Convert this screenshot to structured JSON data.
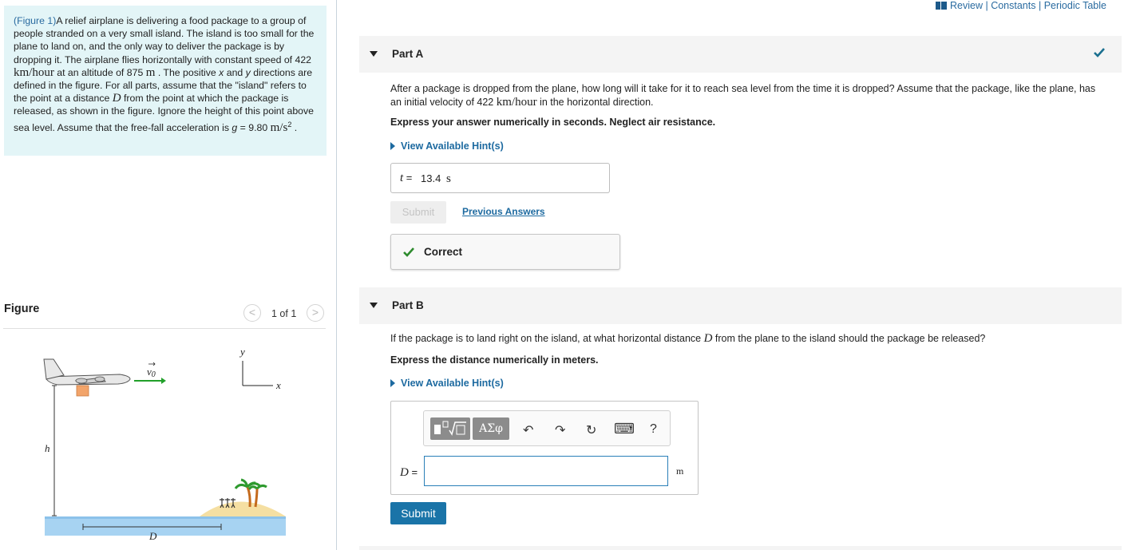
{
  "topbar": {
    "review": "Review",
    "sep1": "|",
    "constants": "Constants",
    "sep2": "|",
    "periodic_table": "Periodic Table"
  },
  "problem": {
    "figure_link": "(Figure 1)",
    "text_1": "A relief airplane is delivering a food package to a group of people stranded on a very small island. The island is too small for the plane to land on, and the only way to deliver the package is by dropping it. The airplane flies horizontally with constant speed of ",
    "speed": "422",
    "speed_unit": "km/hour",
    "text_2": " at an altitude of ",
    "altitude": "875",
    "altitude_unit": "m",
    "text_3": " . The positive ",
    "x": "x",
    "text_4": " and ",
    "y": "y",
    "text_5": " directions are defined in the figure. For all parts, assume that the \"island\" refers to the point at a distance ",
    "D": "D",
    "text_6": " from the point at which the package is released, as shown in the figure. Ignore the height of this point above sea level. Assume that the free-fall acceleration is ",
    "g": "g",
    "g_eq": " = 9.80 ",
    "g_unit": "m/s",
    "g_exp": "2",
    "text_7": " ."
  },
  "figure": {
    "title": "Figure",
    "prev": "<",
    "counter": "1 of 1",
    "next": ">",
    "label_v0": "v",
    "label_v0_sub": "0",
    "label_y": "y",
    "label_x": "x",
    "label_h": "h",
    "label_D": "D"
  },
  "partA": {
    "label": "Part A",
    "question_1": "After a package is dropped from the plane, how long will it take for it to reach sea level from the time it is dropped? Assume that the package, like the plane, has an initial velocity of ",
    "speed": "422",
    "speed_unit": "km/hour",
    "question_2": " in the horizontal direction.",
    "instruction": "Express your answer numerically in seconds. Neglect air resistance.",
    "hint": "View Available Hint(s)",
    "answer_var": "t",
    "answer_eq": " = ",
    "answer_value": "13.4",
    "answer_unit": "s",
    "submit": "Submit",
    "previous_answers": "Previous Answers",
    "feedback": "Correct"
  },
  "partB": {
    "label": "Part B",
    "question_1": "If the package is to land right on the island, at what horizontal distance ",
    "D": "D",
    "question_2": " from the plane to the island should the package be released?",
    "instruction": "Express the distance numerically in meters.",
    "hint": "View Available Hint(s)",
    "toolbar_greek": "ΑΣφ",
    "toolbar_undo": "↶",
    "toolbar_redo": "↷",
    "toolbar_reset": "↻",
    "toolbar_keyboard": "⌨",
    "toolbar_help": "?",
    "answer_var": "D",
    "answer_eq": " =",
    "answer_value": "",
    "answer_unit": "m",
    "submit": "Submit"
  },
  "colors": {
    "accent": "#1d6aa0",
    "problem_bg": "#e3f5f7",
    "correct_green": "#2e8b2e",
    "submit_blue": "#1a74a8"
  }
}
